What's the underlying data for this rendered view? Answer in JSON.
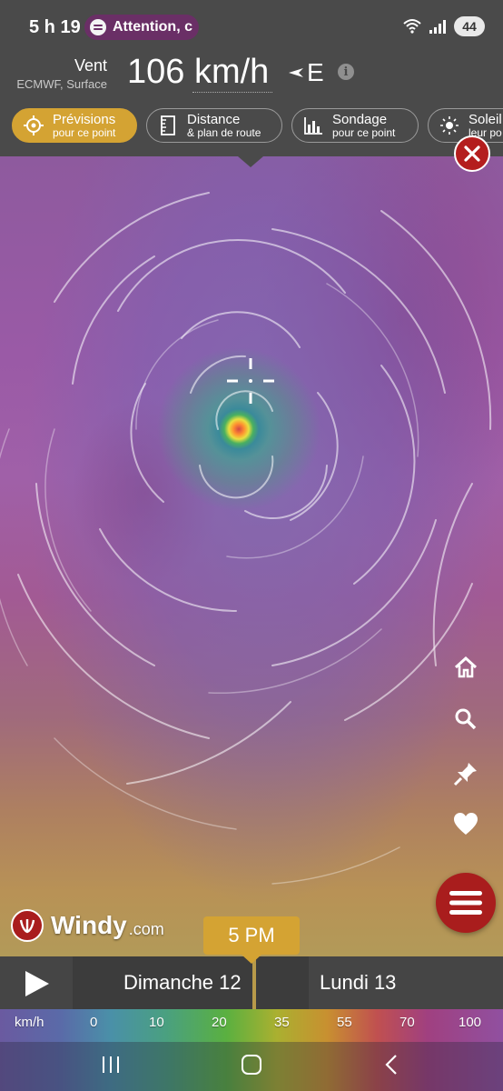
{
  "status_bar": {
    "time": "5 h 19",
    "notification_text": "Attention, c",
    "battery": "44"
  },
  "header": {
    "title": "Vent",
    "source": "ECMWF, Surface",
    "wind_speed": "106 km/h",
    "direction": "E"
  },
  "toolbar": {
    "items": [
      {
        "label": "Prévisions",
        "sublabel": "pour ce point"
      },
      {
        "label": "Distance",
        "sublabel": "& plan de route"
      },
      {
        "label": "Sondage",
        "sublabel": "pour ce point"
      },
      {
        "label": "Soleil",
        "sublabel": "leur po"
      }
    ]
  },
  "map": {
    "logo_name": "Windy",
    "logo_domain": ".com"
  },
  "timeline": {
    "current_time": "5 PM",
    "days": [
      "Dimanche 12",
      "Lundi 13"
    ]
  },
  "scale": {
    "unit": "km/h",
    "values": [
      "0",
      "10",
      "20",
      "35",
      "55",
      "70",
      "100"
    ]
  },
  "colors": {
    "accent": "#d4a333",
    "brand_red": "#a91d1d",
    "bar_bg": "#4a4a4a"
  },
  "icons": {
    "side": [
      "home-icon",
      "search-icon",
      "pin-icon",
      "heart-icon"
    ],
    "nav": [
      "recent-apps-icon",
      "home-nav-icon",
      "back-icon"
    ]
  }
}
